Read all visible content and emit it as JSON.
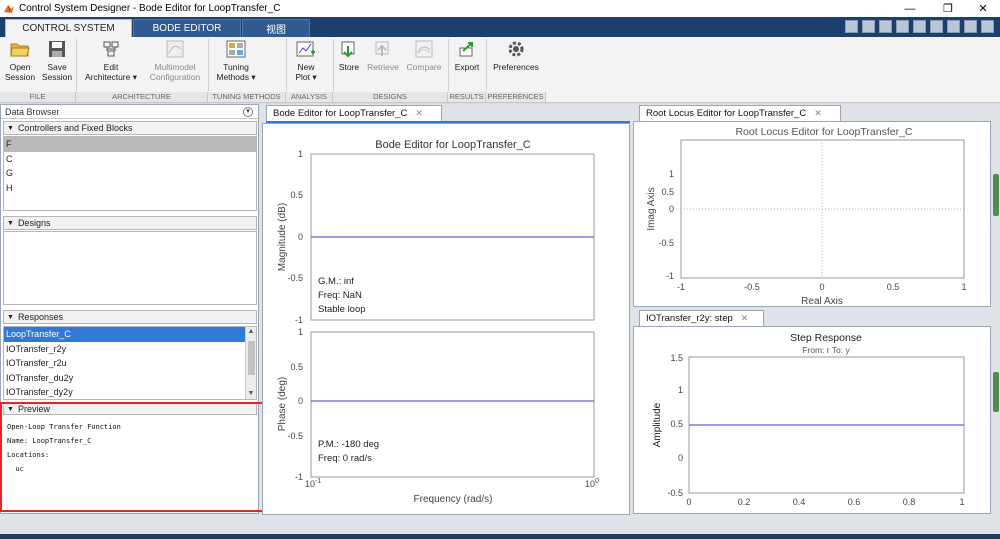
{
  "window": {
    "title": "Control System Designer - Bode Editor for LoopTransfer_C",
    "controls": [
      "—",
      "❐",
      "✕"
    ]
  },
  "ribbon_tabs": [
    {
      "label": "CONTROL SYSTEM",
      "active": true
    },
    {
      "label": "BODE EDITOR",
      "active": false
    },
    {
      "label": "视图",
      "active": false
    }
  ],
  "ribbon": {
    "open_session": "Open\nSession",
    "save_session": "Save\nSession",
    "edit_architecture": "Edit\nArchitecture ▾",
    "multimodel": "Multimodel\nConfiguration",
    "tuning_methods": "Tuning\nMethods ▾",
    "new_plot": "New\nPlot ▾",
    "store": "Store",
    "retrieve": "Retrieve",
    "compare": "Compare",
    "export": "Export",
    "preferences": "Preferences",
    "sections": {
      "file": "FILE",
      "architecture": "ARCHITECTURE",
      "tuning": "TUNING METHODS",
      "analysis": "ANALYSIS",
      "designs": "DESIGNS",
      "results": "RESULTS",
      "preferences": "PREFERENCES"
    }
  },
  "data_browser": {
    "title": "Data Browser",
    "controllers": {
      "header": "Controllers and Fixed Blocks",
      "items": [
        "F",
        "C",
        "G",
        "H"
      ]
    },
    "designs": {
      "header": "Designs"
    },
    "responses": {
      "header": "Responses",
      "items": [
        "LoopTransfer_C",
        "IOTransfer_r2y",
        "IOTransfer_r2u",
        "IOTransfer_du2y",
        "IOTransfer_dy2y"
      ]
    },
    "preview": {
      "header": "Preview",
      "lines": [
        "Open-Loop Transfer Function",
        "Name: LoopTransfer_C",
        "Locations:",
        "  uc"
      ]
    }
  },
  "bode": {
    "tab": "Bode Editor for LoopTransfer_C",
    "title": "Bode Editor for LoopTransfer_C",
    "mag_ylabel": "Magnitude (dB)",
    "phase_ylabel": "Phase (deg)",
    "xlabel": "Frequency (rad/s)",
    "mag_ticks": [
      "1",
      "0.5",
      "0",
      "-0.5",
      "-1"
    ],
    "phase_ticks": [
      "1",
      "0.5",
      "0",
      "-0.5",
      "-1"
    ],
    "x_tick_left_base": "10",
    "x_tick_left_exp": "-1",
    "x_tick_right_base": "10",
    "x_tick_right_exp": "0",
    "margin_gm": "G.M.: inf",
    "margin_freq": "Freq: NaN",
    "margin_stable": "Stable loop",
    "margin_pm": "P.M.: -180 deg",
    "margin_pfreq": "Freq: 0 rad/s"
  },
  "root_locus": {
    "tab": "Root Locus Editor for LoopTransfer_C",
    "title": "Root Locus Editor for LoopTransfer_C",
    "ylabel": "Imag Axis",
    "xlabel": "Real Axis",
    "y_ticks": [
      "1",
      "0.5",
      "0",
      "-0.5",
      "-1"
    ],
    "x_ticks": [
      "-1",
      "-0.5",
      "0",
      "0.5",
      "1"
    ]
  },
  "step": {
    "tab": "IOTransfer_r2y: step",
    "title": "Step Response",
    "subtitle": "From: r  To: y",
    "ylabel": "Amplitude",
    "y_ticks": [
      "1.5",
      "1",
      "0.5",
      "0",
      "-0.5"
    ],
    "x_ticks": [
      "0",
      "0.2",
      "0.4",
      "0.6",
      "0.8",
      "1"
    ]
  },
  "colors": {
    "line": "#3b3bd6",
    "accent": "#3079d6",
    "highlight": "#e8232b"
  }
}
